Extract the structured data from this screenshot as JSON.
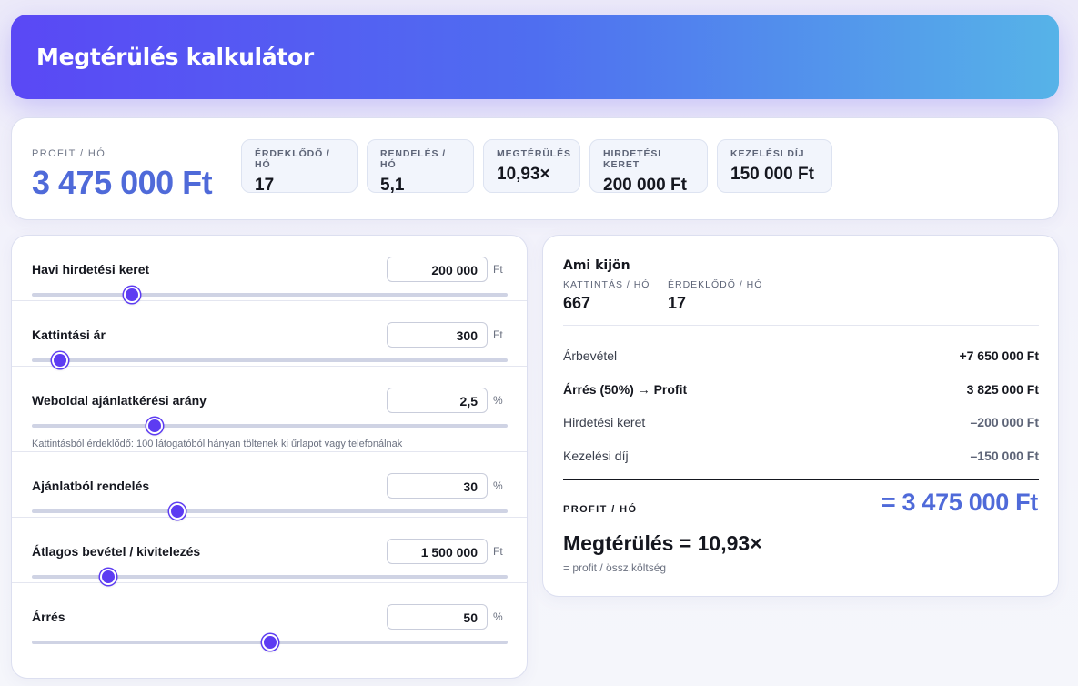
{
  "title": "Megtérülés kalkulátor",
  "summary": {
    "profit_label": "PROFIT / HÓ",
    "profit_value": "3 475 000 Ft",
    "chips": [
      {
        "label": "ÉRDEKLŐDŐ / HÓ",
        "value": "17"
      },
      {
        "label": "RENDELÉS / HÓ",
        "value": "5,1"
      },
      {
        "label": "MEGTÉRÜLÉS",
        "value": "10,93×"
      },
      {
        "label": "HIRDETÉSI KERET",
        "value": "200 000 Ft"
      },
      {
        "label": "KEZELÉSI DÍJ",
        "value": "150 000 Ft"
      }
    ]
  },
  "inputs": [
    {
      "label": "Havi hirdetési keret",
      "value": "200 000",
      "unit": "Ft",
      "slider_fraction": 0.21
    },
    {
      "label": "Kattintási ár",
      "value": "300",
      "unit": "Ft",
      "slider_fraction": 0.06
    },
    {
      "label": "Weboldal ajánlatkérési arány",
      "value": "2,5",
      "unit": "%",
      "slider_fraction": 0.258,
      "hint": "Kattintásból érdeklődő: 100 látogatóból hányan töltenek ki űrlapot vagy telefonálnak"
    },
    {
      "label": "Ajánlatból rendelés",
      "value": "30",
      "unit": "%",
      "slider_fraction": 0.305
    },
    {
      "label": "Átlagos bevétel / kivitelezés",
      "value": "1 500 000",
      "unit": "Ft",
      "slider_fraction": 0.16
    },
    {
      "label": "Árrés",
      "value": "50",
      "unit": "%",
      "slider_fraction": 0.5
    }
  ],
  "result": {
    "title": "Ami kijön",
    "kpis": [
      {
        "label": "KATTINTÁS / HÓ",
        "value": "667"
      },
      {
        "label": "ÉRDEKLŐDŐ / HÓ",
        "value": "17"
      }
    ],
    "lines": [
      {
        "label": "Árbevétel",
        "value": "+7 650 000 Ft"
      },
      {
        "label": "Árrés (50%) → Profit",
        "value": "3 825 000 Ft"
      },
      {
        "label": "Hirdetési keret",
        "value": "–200 000 Ft"
      },
      {
        "label": "Kezelési díj",
        "value": "–150 000 Ft"
      }
    ],
    "profit_label": "PROFIT / HÓ",
    "profit_value": "= 3 475 000 Ft",
    "roi": "Megtérülés = 10,93×",
    "roi_sub": "= profit / össz.költség"
  }
}
